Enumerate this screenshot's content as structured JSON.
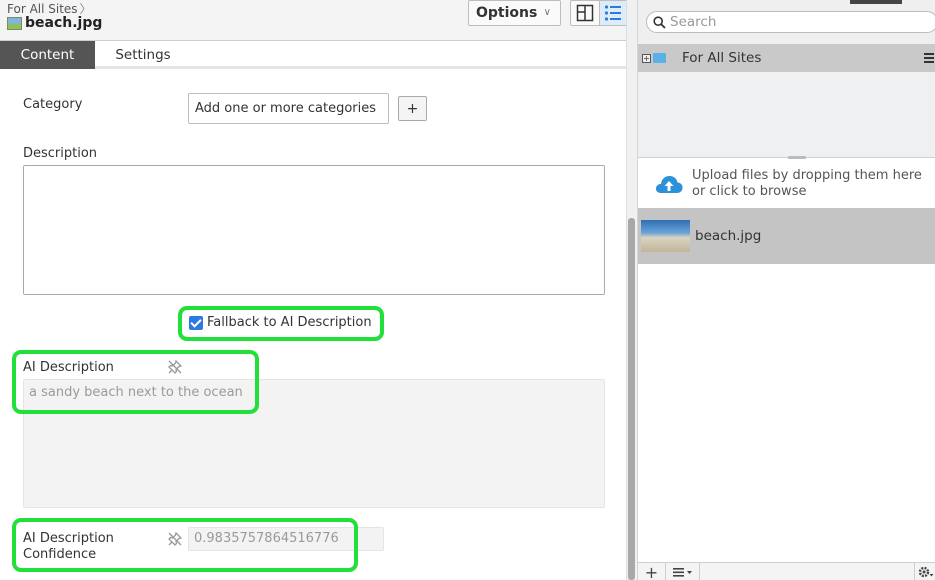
{
  "header": {
    "breadcrumb": "For All Sites",
    "file_title": "beach.jpg",
    "options_label": "Options"
  },
  "tabs": [
    {
      "label": "Content",
      "active": true
    },
    {
      "label": "Settings",
      "active": false
    }
  ],
  "form": {
    "category_label": "Category",
    "category_placeholder": "Add one or more categories",
    "category_add_label": "+",
    "description_label": "Description",
    "description_value": "",
    "fallback_label": "Fallback to AI Description",
    "fallback_checked": true,
    "ai_description_label": "AI Description",
    "ai_description_value": "a sandy beach next to the ocean",
    "ai_confidence_label_line1": "AI Description",
    "ai_confidence_label_line2": "Confidence",
    "ai_confidence_value": "0.9835757864516776"
  },
  "sidebar": {
    "search_placeholder": "Search",
    "site_name": "For All Sites",
    "upload_text": "Upload files by dropping them here or click to browse",
    "files": [
      {
        "name": "beach.jpg",
        "selected": true
      }
    ]
  },
  "bottom_bar": {
    "add_label": "+"
  },
  "colors": {
    "highlight": "#22e03a",
    "active_tab": "#555555",
    "accent": "#2d7be0",
    "selected_row": "#c4c4c4"
  }
}
